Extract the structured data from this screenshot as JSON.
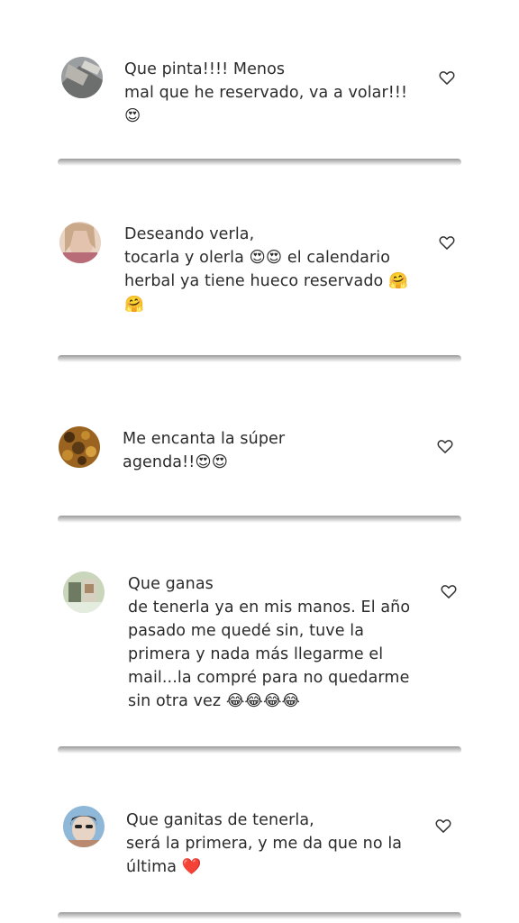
{
  "comments": [
    {
      "text": "                  Que pinta!!!! Menos\nmal que he reservado, va a volar!!! 😍",
      "like_icon": "heart-outline-icon",
      "avatar_colors": [
        "#8a8f92",
        "#6d6f6e",
        "#b7b4ae"
      ]
    },
    {
      "text": "                      Deseando verla,\ntocarla y olerla 😍😍 el calendario\nherbal ya tiene hueco reservado 🤗\n🤗",
      "like_icon": "heart-outline-icon",
      "avatar_colors": [
        "#c89a86",
        "#e4c3ae",
        "#7a5448"
      ]
    },
    {
      "text": "             Me encanta la súper\nagenda!!😍😍",
      "like_icon": "heart-outline-icon",
      "avatar_colors": [
        "#8a5a1c",
        "#c48a2e",
        "#4a2e10"
      ]
    },
    {
      "text": "                                Que ganas\nde tenerla ya en mis manos. El año\npasado me quedé sin, tuve la\nprimera y nada más llegarme el\nmail...la compré para no quedarme\nsin otra vez 😂😂😂😂",
      "like_icon": "heart-outline-icon",
      "avatar_colors": [
        "#a7b59a",
        "#d6d0c0",
        "#6e7a62"
      ]
    },
    {
      "text": "                         Que ganitas de tenerla,\nserá la primera, y me da que no la\núltima ❤️",
      "like_icon": "heart-outline-icon",
      "avatar_colors": [
        "#b98a70",
        "#e8d4c4",
        "#3a2c26"
      ]
    }
  ]
}
